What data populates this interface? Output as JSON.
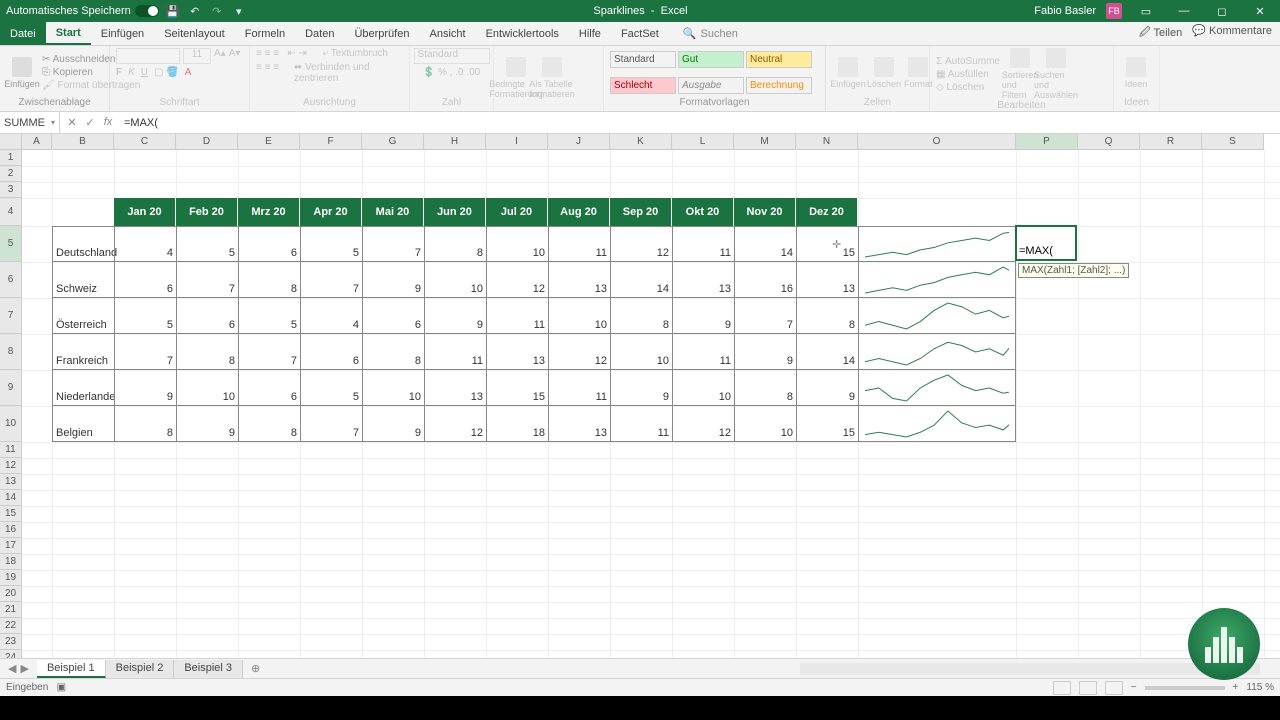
{
  "title": {
    "doc": "Sparklines",
    "app": "Excel",
    "autosave": "Automatisches Speichern",
    "user": "Fabio Basler",
    "user_initials": "FB"
  },
  "tabs": {
    "file": "Datei",
    "list": [
      "Start",
      "Einfügen",
      "Seitenlayout",
      "Formeln",
      "Daten",
      "Überprüfen",
      "Ansicht",
      "Entwicklertools",
      "Hilfe",
      "FactSet"
    ],
    "active": "Start",
    "search": "Suchen",
    "share": "Teilen",
    "comments": "Kommentare"
  },
  "ribbon": {
    "clipboard": {
      "paste": "Einfügen",
      "cut": "Ausschneiden",
      "copy": "Kopieren",
      "format_painter": "Format übertragen",
      "label": "Zwischenablage"
    },
    "font": {
      "size": "11",
      "label": "Schriftart"
    },
    "align": {
      "wrap": "Textumbruch",
      "merge": "Verbinden und zentrieren",
      "label": "Ausrichtung"
    },
    "number": {
      "format": "Standard",
      "label": "Zahl"
    },
    "cond": {
      "cond_fmt": "Bedingte Formatierung",
      "table_fmt": "Als Tabelle formatieren"
    },
    "styles": {
      "standard": "Standard",
      "gut": "Gut",
      "neutral": "Neutral",
      "schlecht": "Schlecht",
      "ausgabe": "Ausgabe",
      "berechnung": "Berechnung",
      "label": "Formatvorlagen"
    },
    "cells": {
      "insert": "Einfügen",
      "delete": "Löschen",
      "format": "Format",
      "label": "Zellen"
    },
    "editing": {
      "autosum": "AutoSumme",
      "fill": "Ausfüllen",
      "clear": "Löschen",
      "sort": "Sortieren und Filtern",
      "find": "Suchen und Auswählen",
      "label": "Bearbeiten"
    },
    "ideas": {
      "label": "Ideen"
    }
  },
  "formula": {
    "name_box": "SUMME",
    "value": "=MAX("
  },
  "columns": [
    "A",
    "B",
    "C",
    "D",
    "E",
    "F",
    "G",
    "H",
    "I",
    "J",
    "K",
    "L",
    "M",
    "N",
    "O",
    "P",
    "Q",
    "R",
    "S"
  ],
  "months": [
    "Jan 20",
    "Feb 20",
    "Mrz 20",
    "Apr 20",
    "Mai 20",
    "Jun 20",
    "Jul 20",
    "Aug 20",
    "Sep 20",
    "Okt 20",
    "Nov 20",
    "Dez 20"
  ],
  "rows": [
    {
      "country": "Deutschland",
      "values": [
        4,
        5,
        6,
        5,
        7,
        8,
        10,
        11,
        12,
        11,
        14,
        15
      ]
    },
    {
      "country": "Schweiz",
      "values": [
        6,
        7,
        8,
        7,
        9,
        10,
        12,
        13,
        14,
        13,
        16,
        13
      ]
    },
    {
      "country": "Österreich",
      "values": [
        5,
        6,
        5,
        4,
        6,
        9,
        11,
        10,
        8,
        9,
        7,
        8
      ]
    },
    {
      "country": "Frankreich",
      "values": [
        7,
        8,
        7,
        6,
        8,
        11,
        13,
        12,
        10,
        11,
        9,
        14
      ]
    },
    {
      "country": "Niederlande",
      "values": [
        9,
        10,
        6,
        5,
        10,
        13,
        15,
        11,
        9,
        10,
        8,
        9
      ]
    },
    {
      "country": "Belgien",
      "values": [
        8,
        9,
        8,
        7,
        9,
        12,
        18,
        13,
        11,
        12,
        10,
        15
      ]
    }
  ],
  "active_cell_text": "=MAX(",
  "tooltip": "MAX(Zahl1; [Zahl2]; ...)",
  "sheets": {
    "list": [
      "Beispiel 1",
      "Beispiel 2",
      "Beispiel 3"
    ],
    "active": "Beispiel 1"
  },
  "status": {
    "mode": "Eingeben",
    "zoom": "115 %"
  },
  "chart_data": {
    "type": "line",
    "note": "Sparklines in column O, one per country row, x=months, y=values",
    "categories": [
      "Jan 20",
      "Feb 20",
      "Mrz 20",
      "Apr 20",
      "Mai 20",
      "Jun 20",
      "Jul 20",
      "Aug 20",
      "Sep 20",
      "Okt 20",
      "Nov 20",
      "Dez 20"
    ],
    "series": [
      {
        "name": "Deutschland",
        "values": [
          4,
          5,
          6,
          5,
          7,
          8,
          10,
          11,
          12,
          11,
          14,
          15
        ]
      },
      {
        "name": "Schweiz",
        "values": [
          6,
          7,
          8,
          7,
          9,
          10,
          12,
          13,
          14,
          13,
          16,
          13
        ]
      },
      {
        "name": "Österreich",
        "values": [
          5,
          6,
          5,
          4,
          6,
          9,
          11,
          10,
          8,
          9,
          7,
          8
        ]
      },
      {
        "name": "Frankreich",
        "values": [
          7,
          8,
          7,
          6,
          8,
          11,
          13,
          12,
          10,
          11,
          9,
          14
        ]
      },
      {
        "name": "Niederlande",
        "values": [
          9,
          10,
          6,
          5,
          10,
          13,
          15,
          11,
          9,
          10,
          8,
          9
        ]
      },
      {
        "name": "Belgien",
        "values": [
          8,
          9,
          8,
          7,
          9,
          12,
          18,
          13,
          11,
          12,
          10,
          15
        ]
      }
    ]
  }
}
